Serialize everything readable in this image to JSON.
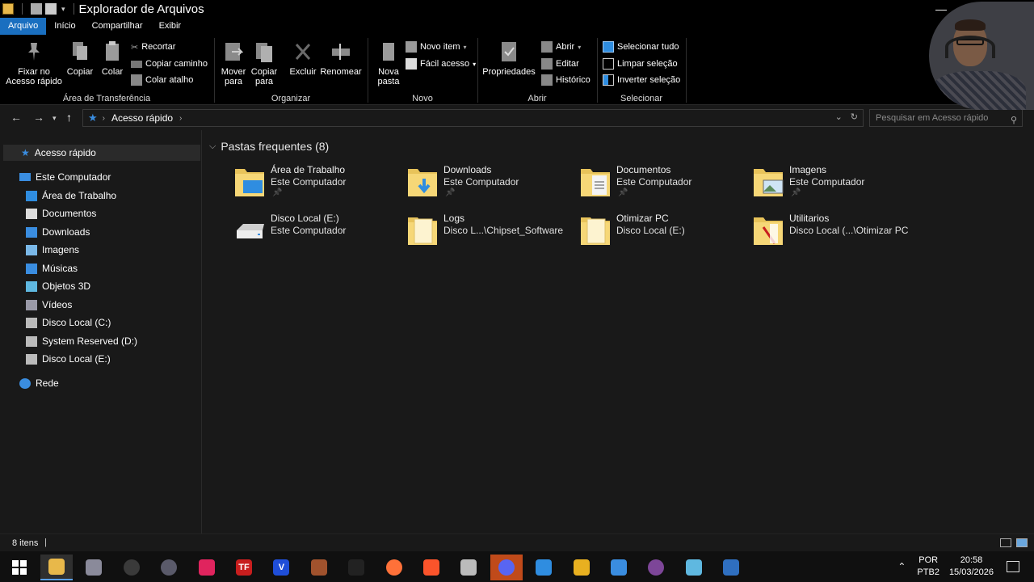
{
  "window": {
    "title": "Explorador de Arquivos",
    "min": "—",
    "close": "✕"
  },
  "ribbon_tabs": [
    "Arquivo",
    "Início",
    "Compartilhar",
    "Exibir"
  ],
  "ribbon": {
    "clipboard": {
      "pin_line1": "Fixar no",
      "pin_line2": "Acesso rápido",
      "copy": "Copiar",
      "paste": "Colar",
      "cut": "Recortar",
      "copy_path": "Copiar caminho",
      "paste_shortcut": "Colar atalho",
      "label": "Área de Transferência"
    },
    "organize": {
      "move_line1": "Mover",
      "move_line2": "para",
      "copyto_line1": "Copiar",
      "copyto_line2": "para",
      "delete": "Excluir",
      "rename": "Renomear",
      "label": "Organizar"
    },
    "new": {
      "newfolder_line1": "Nova",
      "newfolder_line2": "pasta",
      "new_item": "Novo item",
      "easy_access": "Fácil acesso",
      "label": "Novo"
    },
    "open": {
      "properties": "Propriedades",
      "open": "Abrir",
      "edit": "Editar",
      "history": "Histórico",
      "label": "Abrir"
    },
    "select": {
      "select_all": "Selecionar tudo",
      "select_none": "Limpar seleção",
      "invert": "Inverter seleção",
      "label": "Selecionar"
    }
  },
  "address": {
    "path": "Acesso rápido",
    "search_placeholder": "Pesquisar em Acesso rápido"
  },
  "sidebar": {
    "quick_access": "Acesso rápido",
    "this_pc": "Este Computador",
    "items": [
      {
        "label": "Área de Trabalho",
        "icon": "desktop-icon",
        "color": "#2f8de0"
      },
      {
        "label": "Documentos",
        "icon": "documents-icon",
        "color": "#dcdcdc"
      },
      {
        "label": "Downloads",
        "icon": "downloads-icon",
        "color": "#3a8de0"
      },
      {
        "label": "Imagens",
        "icon": "pictures-icon",
        "color": "#7ab8e8"
      },
      {
        "label": "Músicas",
        "icon": "music-icon",
        "color": "#3a8de0"
      },
      {
        "label": "Objetos 3D",
        "icon": "3d-objects-icon",
        "color": "#5fb8e0"
      },
      {
        "label": "Vídeos",
        "icon": "videos-icon",
        "color": "#9a9aa8"
      },
      {
        "label": "Disco Local (C:)",
        "icon": "drive-icon",
        "color": "#bbbbbb"
      },
      {
        "label": "System Reserved (D:)",
        "icon": "drive-icon",
        "color": "#bbbbbb"
      },
      {
        "label": "Disco Local (E:)",
        "icon": "drive-icon",
        "color": "#bbbbbb"
      }
    ],
    "network": "Rede"
  },
  "content": {
    "section_title": "Pastas frequentes (8)",
    "tiles": [
      {
        "name": "Área de Trabalho",
        "sub": "Este Computador",
        "pinned": true,
        "icon": "desktop-folder-icon"
      },
      {
        "name": "Downloads",
        "sub": "Este Computador",
        "pinned": true,
        "icon": "downloads-folder-icon"
      },
      {
        "name": "Documentos",
        "sub": "Este Computador",
        "pinned": true,
        "icon": "documents-folder-icon"
      },
      {
        "name": "Imagens",
        "sub": "Este Computador",
        "pinned": true,
        "icon": "pictures-folder-icon"
      },
      {
        "name": "Disco Local (E:)",
        "sub": "Este Computador",
        "pinned": false,
        "icon": "drive-icon"
      },
      {
        "name": "Logs",
        "sub": "Disco L...\\Chipset_Software",
        "pinned": false,
        "icon": "folder-icon"
      },
      {
        "name": "Otimizar PC",
        "sub": "Disco Local (E:)",
        "pinned": false,
        "icon": "folder-icon"
      },
      {
        "name": "Utilitarios",
        "sub": "Disco Local (...\\Otimizar PC",
        "pinned": false,
        "icon": "folder-icon"
      }
    ]
  },
  "status": {
    "item_count": "8 itens"
  },
  "tray": {
    "lang1": "POR",
    "lang2": "PTB2",
    "time": "20:58",
    "date": "15/03/2026"
  },
  "taskbar_apps": [
    {
      "name": "file-explorer-icon",
      "color": "#e8b84a",
      "label": ""
    },
    {
      "name": "taskbar-app-icon",
      "color": "#8a8a9a",
      "label": ""
    },
    {
      "name": "obs-icon",
      "color": "#3a3a3a",
      "label": ""
    },
    {
      "name": "steam-icon",
      "color": "#5a5a6a",
      "label": ""
    },
    {
      "name": "tiktok-icon",
      "color": "#e0245e",
      "label": ""
    },
    {
      "name": "tf-icon",
      "color": "#c81e1e",
      "label": "TF"
    },
    {
      "name": "vegas-icon",
      "color": "#1f4ed8",
      "label": "V"
    },
    {
      "name": "taskbar-app-icon",
      "color": "#a0522d",
      "label": ""
    },
    {
      "name": "capcut-icon",
      "color": "#222222",
      "label": ""
    },
    {
      "name": "firefox-icon",
      "color": "#ff7139",
      "label": ""
    },
    {
      "name": "brave-icon",
      "color": "#fb542b",
      "label": ""
    },
    {
      "name": "taskbar-app-icon",
      "color": "#bbbbbb",
      "label": ""
    },
    {
      "name": "discord-icon",
      "color": "#5865f2",
      "label": ""
    },
    {
      "name": "taskbar-app-icon",
      "color": "#2f8de0",
      "label": ""
    },
    {
      "name": "taskbar-app-icon",
      "color": "#e8b020",
      "label": ""
    },
    {
      "name": "taskbar-app-icon",
      "color": "#3a8de0",
      "label": ""
    },
    {
      "name": "tor-icon",
      "color": "#7d4698",
      "label": ""
    },
    {
      "name": "taskbar-app-icon",
      "color": "#5fb8e0",
      "label": ""
    },
    {
      "name": "calculator-icon",
      "color": "#2f6fc0",
      "label": ""
    }
  ],
  "accent": "#1a6fc0"
}
